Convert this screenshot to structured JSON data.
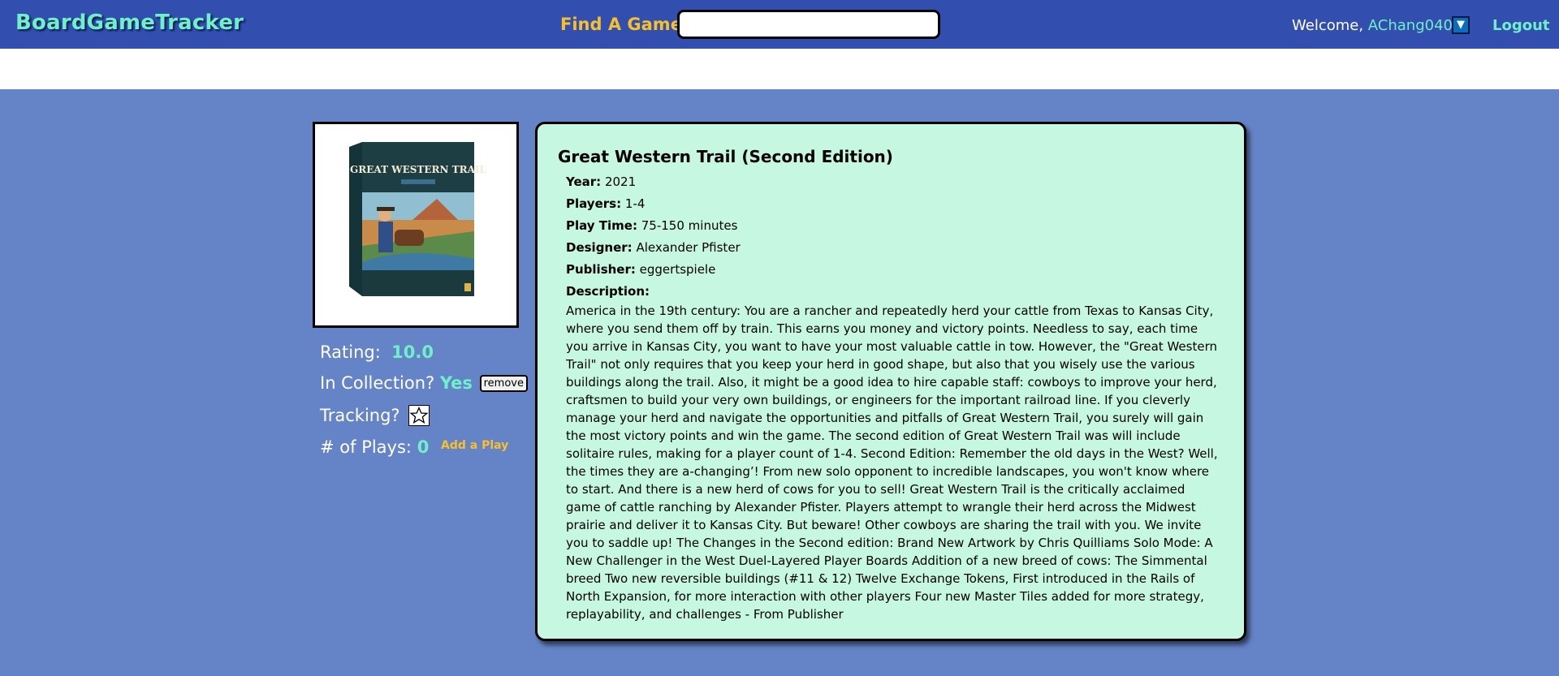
{
  "header": {
    "brand": "BoardGameTracker",
    "find_label": "Find A Game:",
    "search_value": "",
    "welcome_prefix": "Welcome, ",
    "username": "AChang0402",
    "dropdown_glyph": "▼",
    "logout_label": "Logout"
  },
  "colors": {
    "header_bg": "#324fb0",
    "main_bg": "#6584c8",
    "accent_teal": "#6ff0c7",
    "accent_gold": "#f7c02a",
    "card_bg": "#c5f7e1"
  },
  "game": {
    "image_alt": "Great Western Trail box art",
    "box_title": "GREAT WESTERN TRAIL",
    "rating_label": "Rating:",
    "rating_value": "10.0",
    "collection_label": "In Collection?",
    "collection_value": "Yes",
    "remove_label": "remove",
    "tracking_label": "Tracking?",
    "tracking_icon": "star-outline-icon",
    "plays_label": "# of Plays:",
    "plays_value": "0",
    "add_play_label": "Add a Play",
    "title": "Great Western Trail (Second Edition)",
    "fields": [
      {
        "label": "Year:",
        "value": "2021"
      },
      {
        "label": "Players:",
        "value": "1-4"
      },
      {
        "label": "Play Time:",
        "value": "75-150 minutes"
      },
      {
        "label": "Designer:",
        "value": "Alexander Pfister"
      },
      {
        "label": "Publisher:",
        "value": "eggertspiele"
      }
    ],
    "description_label": "Description:",
    "description": "America in the 19th century: You are a rancher and repeatedly herd your cattle from Texas to Kansas City, where you send them off by train. This earns you money and victory points. Needless to say, each time you arrive in Kansas City, you want to have your most valuable cattle in tow. However, the \"Great Western Trail\" not only requires that you keep your herd in good shape, but also that you wisely use the various buildings along the trail. Also, it might be a good idea to hire capable staff: cowboys to improve your herd, craftsmen to build your very own buildings, or engineers for the important railroad line. If you cleverly manage your herd and navigate the opportunities and pitfalls of Great Western Trail, you surely will gain the most victory points and win the game. The second edition of Great Western Trail was will include solitaire rules, making for a player count of 1-4. Second Edition: Remember the old days in the West? Well, the times they are a-changing’! From new solo opponent to incredible landscapes, you won't know where to start. And there is a new herd of cows for you to sell! Great Western Trail is the critically acclaimed game of cattle ranching by Alexander Pfister. Players attempt to wrangle their herd across the Midwest prairie and deliver it to Kansas City. But beware! Other cowboys are sharing the trail with you. We invite you to saddle up! The Changes in the Second edition: Brand New Artwork by Chris Quilliams Solo Mode: A New Challenger in the West Duel-Layered Player Boards Addition of a new breed of cows: The Simmental breed Two new reversible buildings (#11 & 12) Twelve Exchange Tokens, First introduced in the Rails of North Expansion, for more interaction with other players Four new Master Tiles added for more strategy, replayability, and challenges - From Publisher"
  }
}
